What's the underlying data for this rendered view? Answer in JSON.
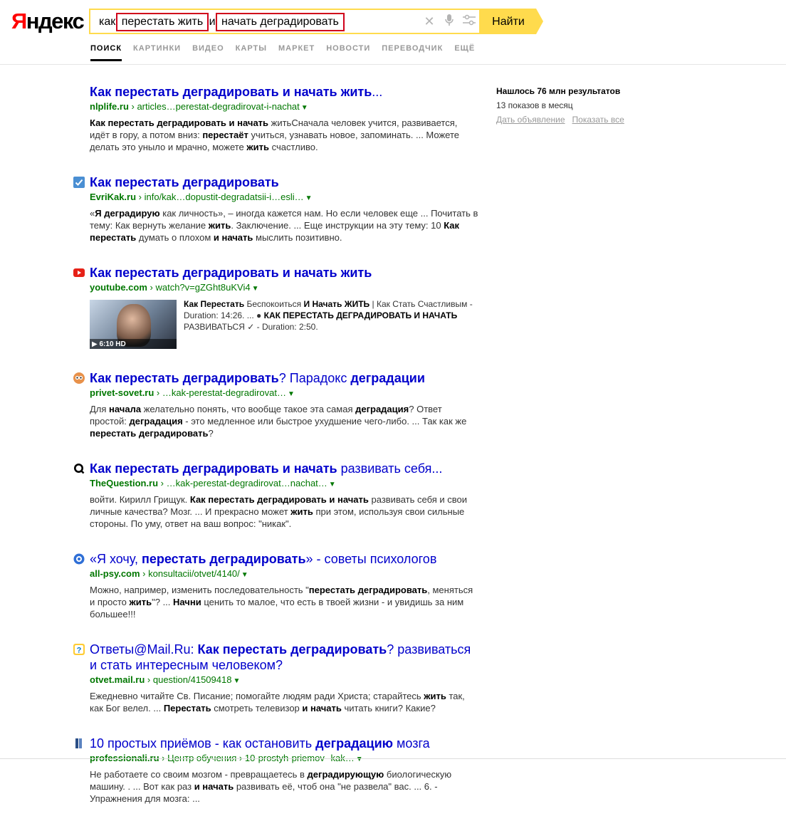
{
  "logo": {
    "ya": "Я",
    "rest": "ндекс"
  },
  "search": {
    "query_prefix": "как",
    "query_hl1": "перестать жить",
    "query_mid": "и",
    "query_hl2": "начать деградировать",
    "button_label": "Найти",
    "icons": [
      "clear-icon",
      "microphone-icon",
      "settings-sliders-icon"
    ]
  },
  "tabs": [
    "ПОИСК",
    "КАРТИНКИ",
    "ВИДЕО",
    "КАРТЫ",
    "МАРКЕТ",
    "НОВОСТИ",
    "ПЕРЕВОДЧИК",
    "ЕЩЁ"
  ],
  "sidebar": {
    "found": "Нашлось 76 млн результатов",
    "shows": "13 показов в месяц",
    "link_ad": "Дать объявление",
    "link_all": "Показать все"
  },
  "results": [
    {
      "favicon": "none",
      "title_html": "<b>Как перестать деградировать и начать жить</b>...",
      "host": "nlplife.ru",
      "path": "articles…perestat-degradirovat-i-nachat",
      "snippet_html": "<b>Как перестать деградировать и начать</b> житьСначала человек учится, развивается, идёт в гору, а потом вниз: <b>перестаёт</b> учиться, узнавать новое, запоминать. ... Можете делать это уныло и мрачно, можете <b>жить</b> счастливо."
    },
    {
      "favicon": "check-square-icon",
      "title_html": "<b>Как перестать деградировать</b>",
      "host": "EvriKak.ru",
      "path": "info/kak…dopustit-degradatsii-i…esli…",
      "snippet_html": "«<b>Я деградирую</b> как личность», – иногда кажется нам. Но если человек еще ... Почитать в тему: Как вернуть желание <b>жить</b>. Заключение. ... Еще инструкции на эту тему: 10 <b>Как перестать</b> думать о плохом <b>и начать</b> мыслить позитивно."
    },
    {
      "favicon": "youtube-icon",
      "title_html": "<b>Как перестать деградировать и начать жить</b>",
      "host": "youtube.com",
      "path": "watch?v=gZGht8uKVi4",
      "video": {
        "duration": "6:10 HD",
        "text_html": "<b>Как Перестать</b> Беспокоиться <b>И Начать ЖИТЬ</b> | Как Стать Счастливым - Duration: 14:26. ... ● <b>КАК ПЕРЕСТАТЬ ДЕГРАДИРОВАТЬ И НАЧАТЬ</b> РАЗВИВАТЬСЯ ✓ - Duration: 2:50."
      }
    },
    {
      "favicon": "owl-icon",
      "title_html": "<b>Как перестать деградировать</b>? Парадокс <b>деградации</b>",
      "host": "privet-sovet.ru",
      "path": "…kak-perestat-degradirovat…",
      "snippet_html": "Для <b>начала</b> желательно понять, что вообще такое эта самая <b>деградация</b>? Ответ простой: <b>деградация</b> - это медленное или быстрое ухудшение чего-либо. ... Так как же <b>перестать деградировать</b>?"
    },
    {
      "favicon": "q-icon",
      "title_html": "<b>Как перестать деградировать и начать</b> развивать себя...",
      "host": "TheQuestion.ru",
      "path": "…kak-perestat-degradirovat…nachat…",
      "snippet_html": "войти. Кирилл Грищук. <b>Как перестать деградировать и начать</b> развивать себя и свои личные качества? Мозг. ... И прекрасно может <b>жить</b> при этом, используя свои сильные стороны. По уму, ответ на ваш вопрос: \"никак\"."
    },
    {
      "favicon": "psy-icon",
      "title_html": "«Я хочу, <b>перестать деградировать</b>» - советы психологов",
      "host": "all-psy.com",
      "path": "konsultacii/otvet/4140/",
      "snippet_html": "Можно, например, изменить последовательность \"<b>перестать деградировать</b>, меняться и просто <b>жить</b>\"? ... <b>Начни</b> ценить то малое, что есть в твоей жизни - и увидишь за ним большее!!!"
    },
    {
      "favicon": "question-icon",
      "title_html": "Ответы@Mail.Ru: <b>Как перестать деградировать</b>? развиваться и стать интересным человеком?",
      "host": "otvet.mail.ru",
      "path": "question/41509418",
      "snippet_html": "Ежедневно читайте Св. Писание; помогайте людям ради Христа; старайтесь <b>жить</b> так, как Бог велел. ... <b>Перестать</b> смотреть телевизор <b>и начать</b> читать книги? Какие?"
    },
    {
      "favicon": "book-icon",
      "title_html": "10 простых приёмов - как остановить <b>деградацию</b> мозга",
      "host": "professionali.ru",
      "path": "Центр обучения › 10-prostyh-priemov--kak…",
      "snippet_html": "Не работаете со своим мозгом - превращаетесь в <b>деградирующую</b> биологическую машину. . ... Вот как раз <b>и начать</b> развивать её, чтоб она \"не развела\" вас. ... 6. - Упражнения для мозга: ..."
    }
  ],
  "colors": {
    "title": "#0000cc",
    "url": "#007700",
    "accent": "#ffdb4d",
    "logo_red": "#ff0000",
    "highlight_box": "#d0021b"
  }
}
